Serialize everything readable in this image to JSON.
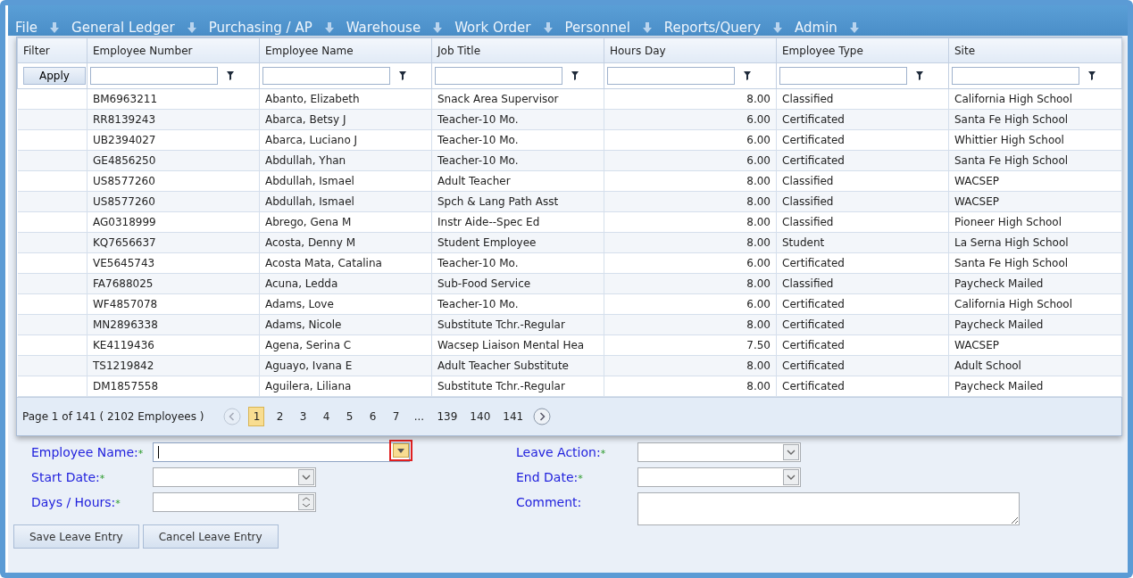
{
  "menu": [
    {
      "label": "File"
    },
    {
      "label": "General Ledger"
    },
    {
      "label": "Purchasing / AP"
    },
    {
      "label": "Warehouse"
    },
    {
      "label": "Work Order"
    },
    {
      "label": "Personnel"
    },
    {
      "label": "Reports/Query"
    },
    {
      "label": "Admin"
    }
  ],
  "grid": {
    "columns": [
      "Filter",
      "Employee Number",
      "Employee Name",
      "Job Title",
      "Hours Day",
      "Employee Type",
      "Site"
    ],
    "apply_button": "Apply",
    "rows": [
      [
        "",
        "BM6963211",
        "Abanto, Elizabeth",
        "Snack Area Supervisor",
        "8.00",
        "Classified",
        "California High School"
      ],
      [
        "",
        "RR8139243",
        "Abarca, Betsy J",
        "Teacher-10 Mo.",
        "6.00",
        "Certificated",
        "Santa Fe High School"
      ],
      [
        "",
        "UB2394027",
        "Abarca, Luciano J",
        "Teacher-10 Mo.",
        "6.00",
        "Certificated",
        "Whittier High School"
      ],
      [
        "",
        "GE4856250",
        "Abdullah, Yhan",
        "Teacher-10 Mo.",
        "6.00",
        "Certificated",
        "Santa Fe High School"
      ],
      [
        "",
        "US8577260",
        "Abdullah, Ismael",
        "Adult Teacher",
        "8.00",
        "Classified",
        "WACSEP"
      ],
      [
        "",
        "US8577260",
        "Abdullah, Ismael",
        "Spch & Lang Path Asst",
        "8.00",
        "Classified",
        "WACSEP"
      ],
      [
        "",
        "AG0318999",
        "Abrego, Gena M",
        "Instr Aide--Spec Ed",
        "8.00",
        "Classified",
        "Pioneer High School"
      ],
      [
        "",
        "KQ7656637",
        "Acosta, Denny M",
        "Student Employee",
        "8.00",
        "Student",
        "La Serna High School"
      ],
      [
        "",
        "VE5645743",
        "Acosta Mata, Catalina",
        "Teacher-10 Mo.",
        "6.00",
        "Certificated",
        "Santa Fe High School"
      ],
      [
        "",
        "FA7688025",
        "Acuna, Ledda",
        "Sub-Food Service",
        "8.00",
        "Classified",
        "Paycheck Mailed"
      ],
      [
        "",
        "WF4857078",
        "Adams, Love",
        "Teacher-10 Mo.",
        "6.00",
        "Certificated",
        "California High School"
      ],
      [
        "",
        "MN2896338",
        "Adams, Nicole",
        "Substitute Tchr.-Regular",
        "8.00",
        "Certificated",
        "Paycheck Mailed"
      ],
      [
        "",
        "KE4119436",
        "Agena, Serina C",
        "Wacsep Liaison Mental Hea",
        "7.50",
        "Certificated",
        "WACSEP"
      ],
      [
        "",
        "TS1219842",
        "Aguayo, Ivana E",
        "Adult Teacher Substitute",
        "8.00",
        "Certificated",
        "Adult School"
      ],
      [
        "",
        "DM1857558",
        "Aguilera, Liliana",
        "Substitute Tchr.-Regular",
        "8.00",
        "Certificated",
        "Paycheck Mailed"
      ]
    ],
    "pager": {
      "summary": "Page 1 of 141 ( 2102 Employees )",
      "prev_disabled": true,
      "pages": [
        {
          "label": "1",
          "selected": true
        },
        {
          "label": "2",
          "selected": false
        },
        {
          "label": "3",
          "selected": false
        },
        {
          "label": "4",
          "selected": false
        },
        {
          "label": "5",
          "selected": false
        },
        {
          "label": "6",
          "selected": false
        },
        {
          "label": "7",
          "selected": false
        },
        {
          "label": "...",
          "selected": false
        },
        {
          "label": "139",
          "selected": false
        },
        {
          "label": "140",
          "selected": false
        },
        {
          "label": "141",
          "selected": false
        }
      ]
    }
  },
  "form": {
    "left": [
      {
        "label": "Employee Name:",
        "marker": "*",
        "kind": "combo",
        "highlighted": true
      },
      {
        "label": "Start Date:",
        "marker": "*",
        "kind": "select"
      },
      {
        "label": "Days / Hours:",
        "marker": "*",
        "kind": "spin"
      }
    ],
    "right": [
      {
        "label": "Leave Action:",
        "marker": "*",
        "kind": "select"
      },
      {
        "label": "End Date:",
        "marker": "*",
        "kind": "select"
      },
      {
        "label": "Comment:",
        "kind": "textarea"
      }
    ],
    "buttons": [
      "Save Leave Entry",
      "Cancel Leave Entry"
    ]
  }
}
